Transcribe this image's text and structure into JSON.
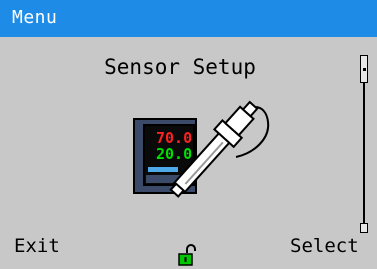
{
  "titlebar": {
    "title": "Menu"
  },
  "main": {
    "heading": "Sensor Setup",
    "icon": "sensor-setup-icon",
    "display": {
      "line1": "70.0",
      "line2": "20.0"
    }
  },
  "scrollbar": {
    "position": 0.0
  },
  "softkeys": {
    "left_label": "Exit",
    "right_label": "Select"
  },
  "status": {
    "lock_icon": "unlocked-padlock-icon",
    "lock_color": "#00c800"
  },
  "colors": {
    "titlebar": "#1e8ce6",
    "background": "#c8c8c8",
    "display_red": "#ff2020",
    "display_green": "#00e000"
  }
}
